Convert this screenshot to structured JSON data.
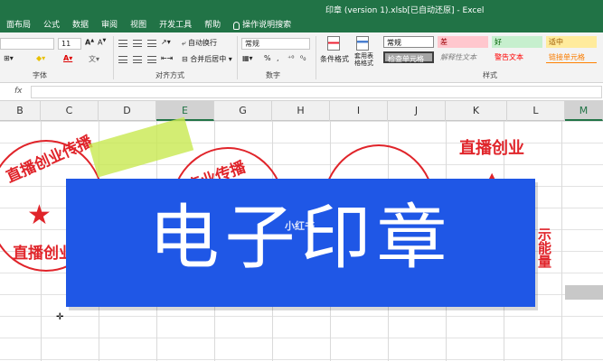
{
  "window": {
    "title": "印章 (version 1).xlsb[已自动还原] - Excel"
  },
  "tabs": [
    "面布局",
    "公式",
    "数据",
    "审阅",
    "视图",
    "开发工具",
    "帮助",
    "操作说明搜索"
  ],
  "ribbon": {
    "font": {
      "name": "",
      "size": "11",
      "group_label": "字体"
    },
    "alignment": {
      "wrap_text": "自动换行",
      "merge_center": "合并后居中",
      "group_label": "对齐方式"
    },
    "number": {
      "format": "常规",
      "group_label": "数字"
    },
    "styles": {
      "conditional_format": "条件格式",
      "format_as_table": "套用表格格式",
      "cells": [
        "常规",
        "差",
        "好",
        "适中",
        "检查单元格",
        "解释性文本",
        "警告文本",
        "链接单元格"
      ],
      "group_label": "样式"
    }
  },
  "columns": [
    "B",
    "C",
    "D",
    "E",
    "G",
    "H",
    "I",
    "J",
    "K",
    "L",
    "M"
  ],
  "selected_column": "E",
  "stamps": {
    "left": {
      "top_text": "直播创业传播",
      "bottom_text": "直播创业"
    },
    "middle": {
      "top_text": "直业传播"
    },
    "right": {
      "top_text": "直播创业",
      "side_text": "示能量"
    }
  },
  "banner": {
    "title": "电子印章",
    "watermark": "小红书"
  },
  "colors": {
    "excel_green": "#217346",
    "stamp_red": "#e0242a",
    "banner_blue": "#1f57e6"
  }
}
